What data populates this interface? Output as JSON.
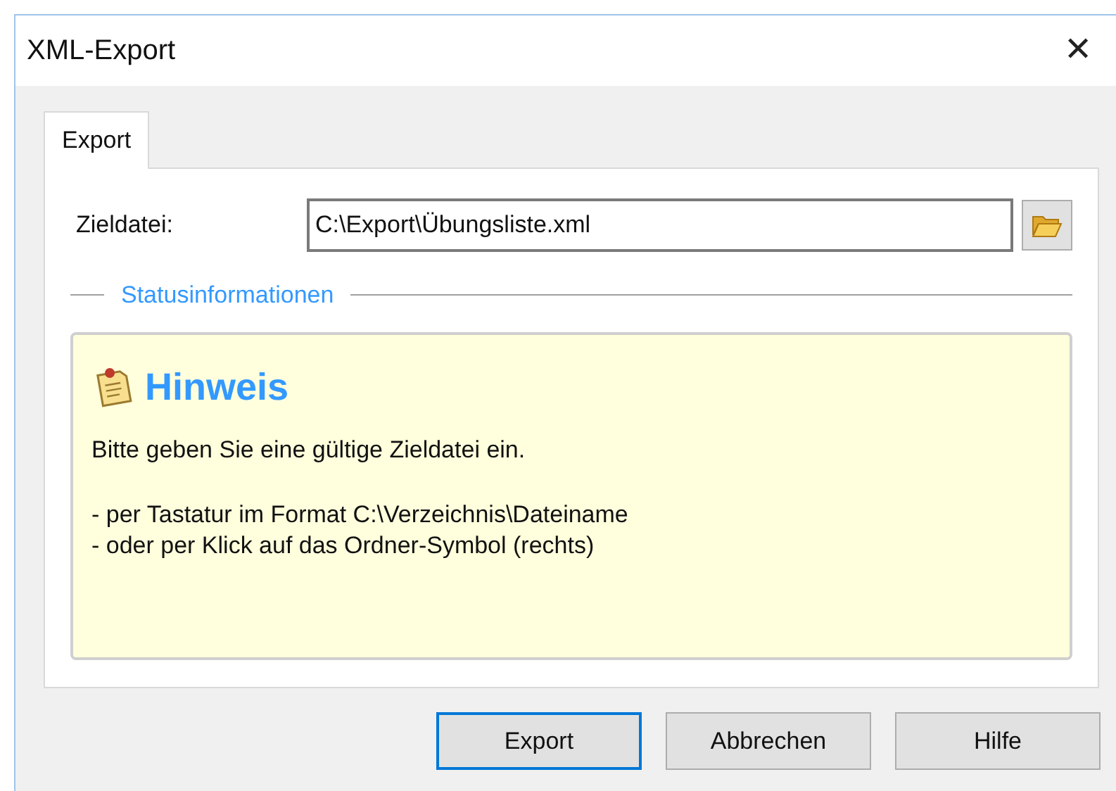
{
  "window": {
    "title": "XML-Export",
    "close": "✕"
  },
  "tabs": [
    {
      "label": "Export",
      "selected": true
    }
  ],
  "target": {
    "label": "Zieldatei:",
    "value": "C:\\Export\\Übungsliste.xml"
  },
  "status": {
    "legend": "Statusinformationen",
    "heading": "Hinweis",
    "message": "Bitte geben Sie eine gültige Zieldatei ein.",
    "lines": [
      "- per Tastatur im Format C:\\Verzeichnis\\Dateiname",
      "- oder per Klick auf das Ordner-Symbol (rechts)"
    ]
  },
  "buttons": [
    {
      "label": "Export",
      "default": true
    },
    {
      "label": "Abbrechen",
      "default": false
    },
    {
      "label": "Hilfe",
      "default": false
    }
  ]
}
